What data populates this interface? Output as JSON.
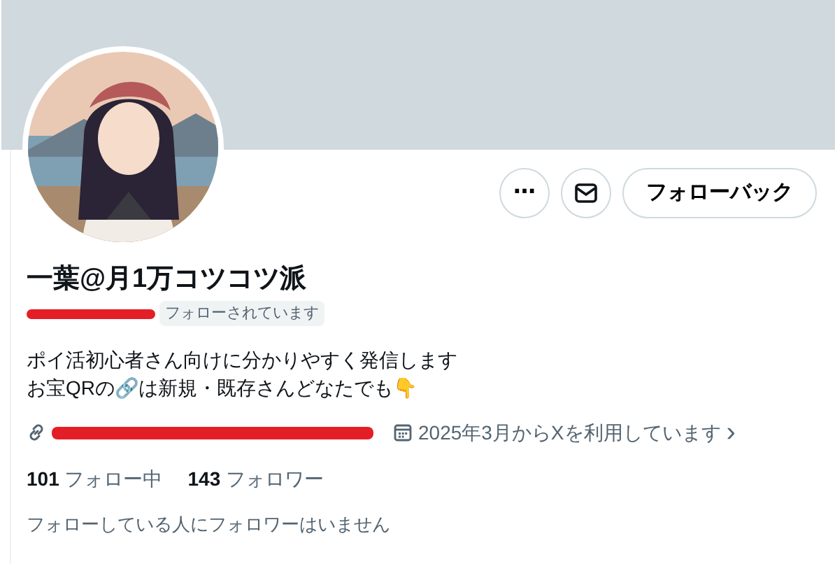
{
  "banner": {
    "kind": "plain"
  },
  "avatar": {
    "kind": "picture"
  },
  "actions": [
    {
      "kind": "more",
      "label": "⋯"
    },
    {
      "kind": "message"
    },
    {
      "kind": "follow",
      "label": "フォローバック"
    }
  ],
  "profile": {
    "name": "一葉@月1万コツコツ派",
    "handle": {
      "redacted": true
    },
    "follows_you": "フォローされています"
  },
  "bio": [
    "ポイ活初心者さん向けに分かりやすく発信します",
    "お宝QRの🔗は新規・既存さんどなたでも👇"
  ],
  "meta": [
    {
      "kind": "link",
      "redacted": true
    },
    {
      "kind": "joined",
      "text": "2025年3月からXを利用しています",
      "chevron": "›"
    }
  ],
  "stats": [
    {
      "count": "101",
      "label": "フォロー中"
    },
    {
      "count": "143",
      "label": "フォロワー"
    }
  ],
  "note": "フォローしている人にフォロワーはいません"
}
